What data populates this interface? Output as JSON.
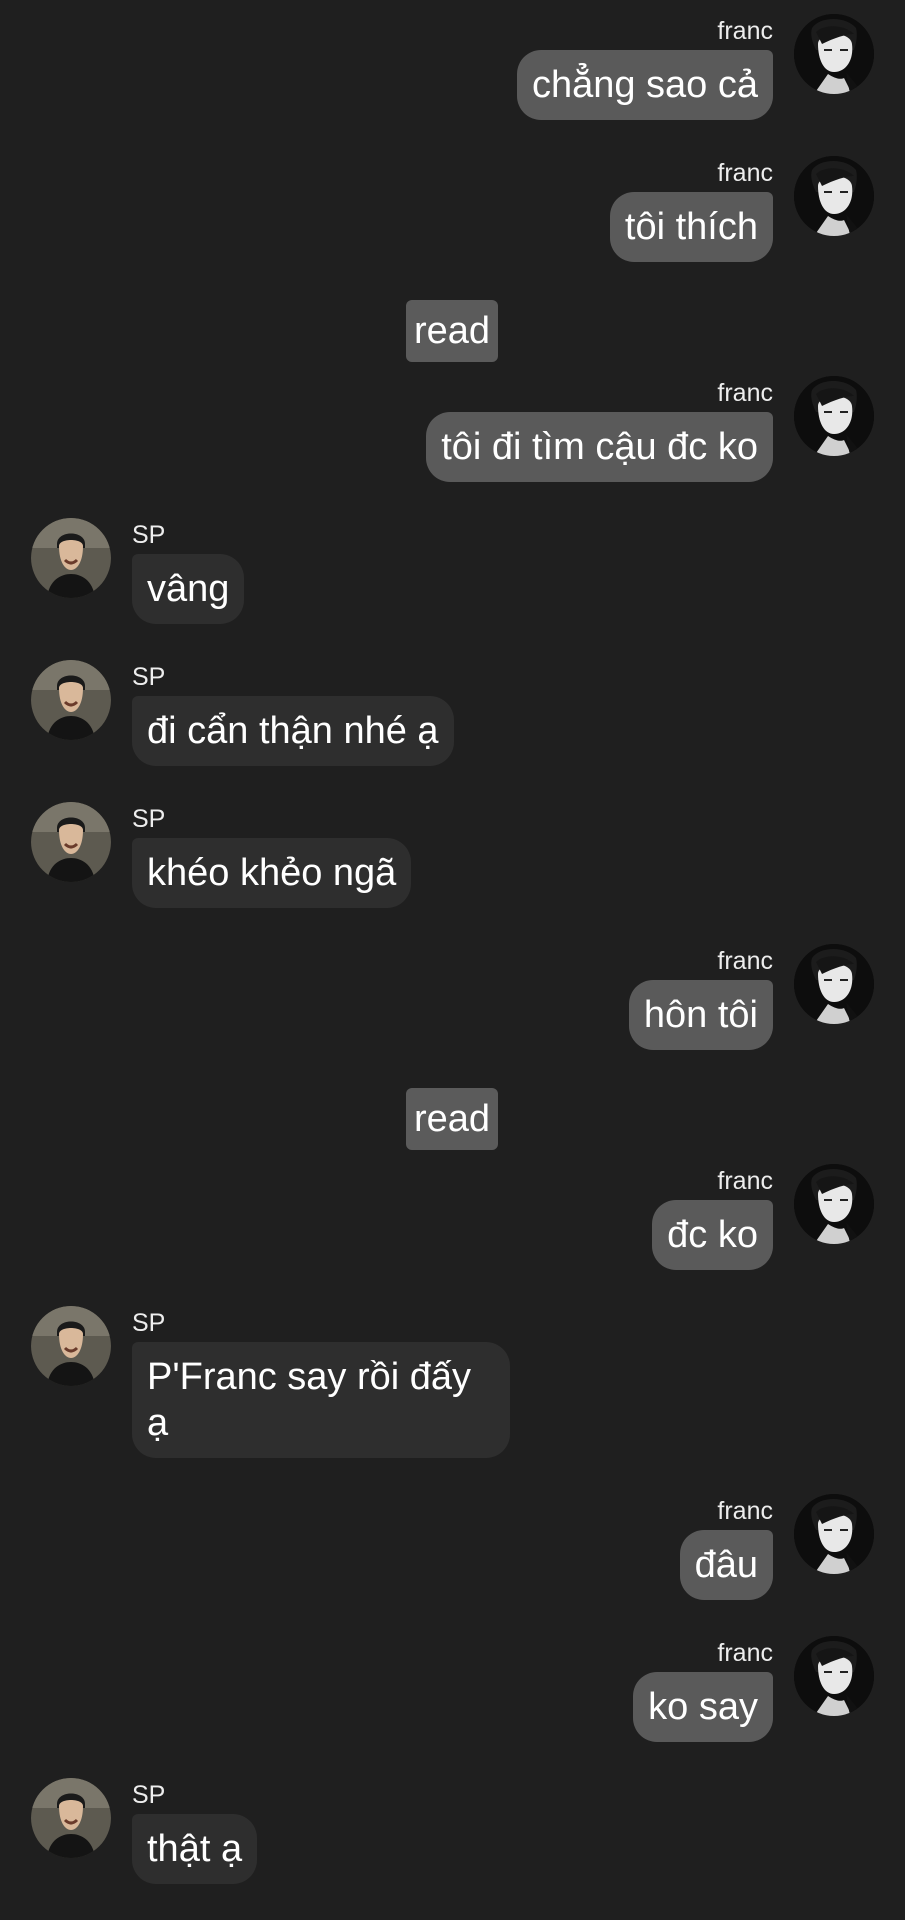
{
  "users": {
    "franc": {
      "name": "franc",
      "avatar_icon": "franc-avatar-icon"
    },
    "sp": {
      "name": "SP",
      "avatar_icon": "sp-avatar-icon"
    }
  },
  "messages": [
    {
      "sender": "franc",
      "text": "chẳng sao cả"
    },
    {
      "sender": "franc",
      "text": "tôi thích"
    },
    {
      "type": "status",
      "text": "read"
    },
    {
      "sender": "franc",
      "text": "tôi đi tìm cậu đc ko"
    },
    {
      "sender": "SP",
      "text": "vâng"
    },
    {
      "sender": "SP",
      "text": "đi cẩn thận nhé ạ"
    },
    {
      "sender": "SP",
      "text": "khéo khẻo ngã"
    },
    {
      "sender": "franc",
      "text": "hôn tôi"
    },
    {
      "type": "status",
      "text": "read"
    },
    {
      "sender": "franc",
      "text": "đc ko"
    },
    {
      "sender": "SP",
      "text": "P'Franc say rồi đấy ạ"
    },
    {
      "sender": "franc",
      "text": "đâu"
    },
    {
      "sender": "franc",
      "text": "ko say"
    },
    {
      "sender": "SP",
      "text": "thật ạ"
    }
  ],
  "colors": {
    "background": "#1f1f1f",
    "outgoing_bubble": "#5a5a5a",
    "incoming_bubble": "#2e2e2e",
    "read_badge": "#5b5b5b",
    "text": "#ffffff"
  }
}
